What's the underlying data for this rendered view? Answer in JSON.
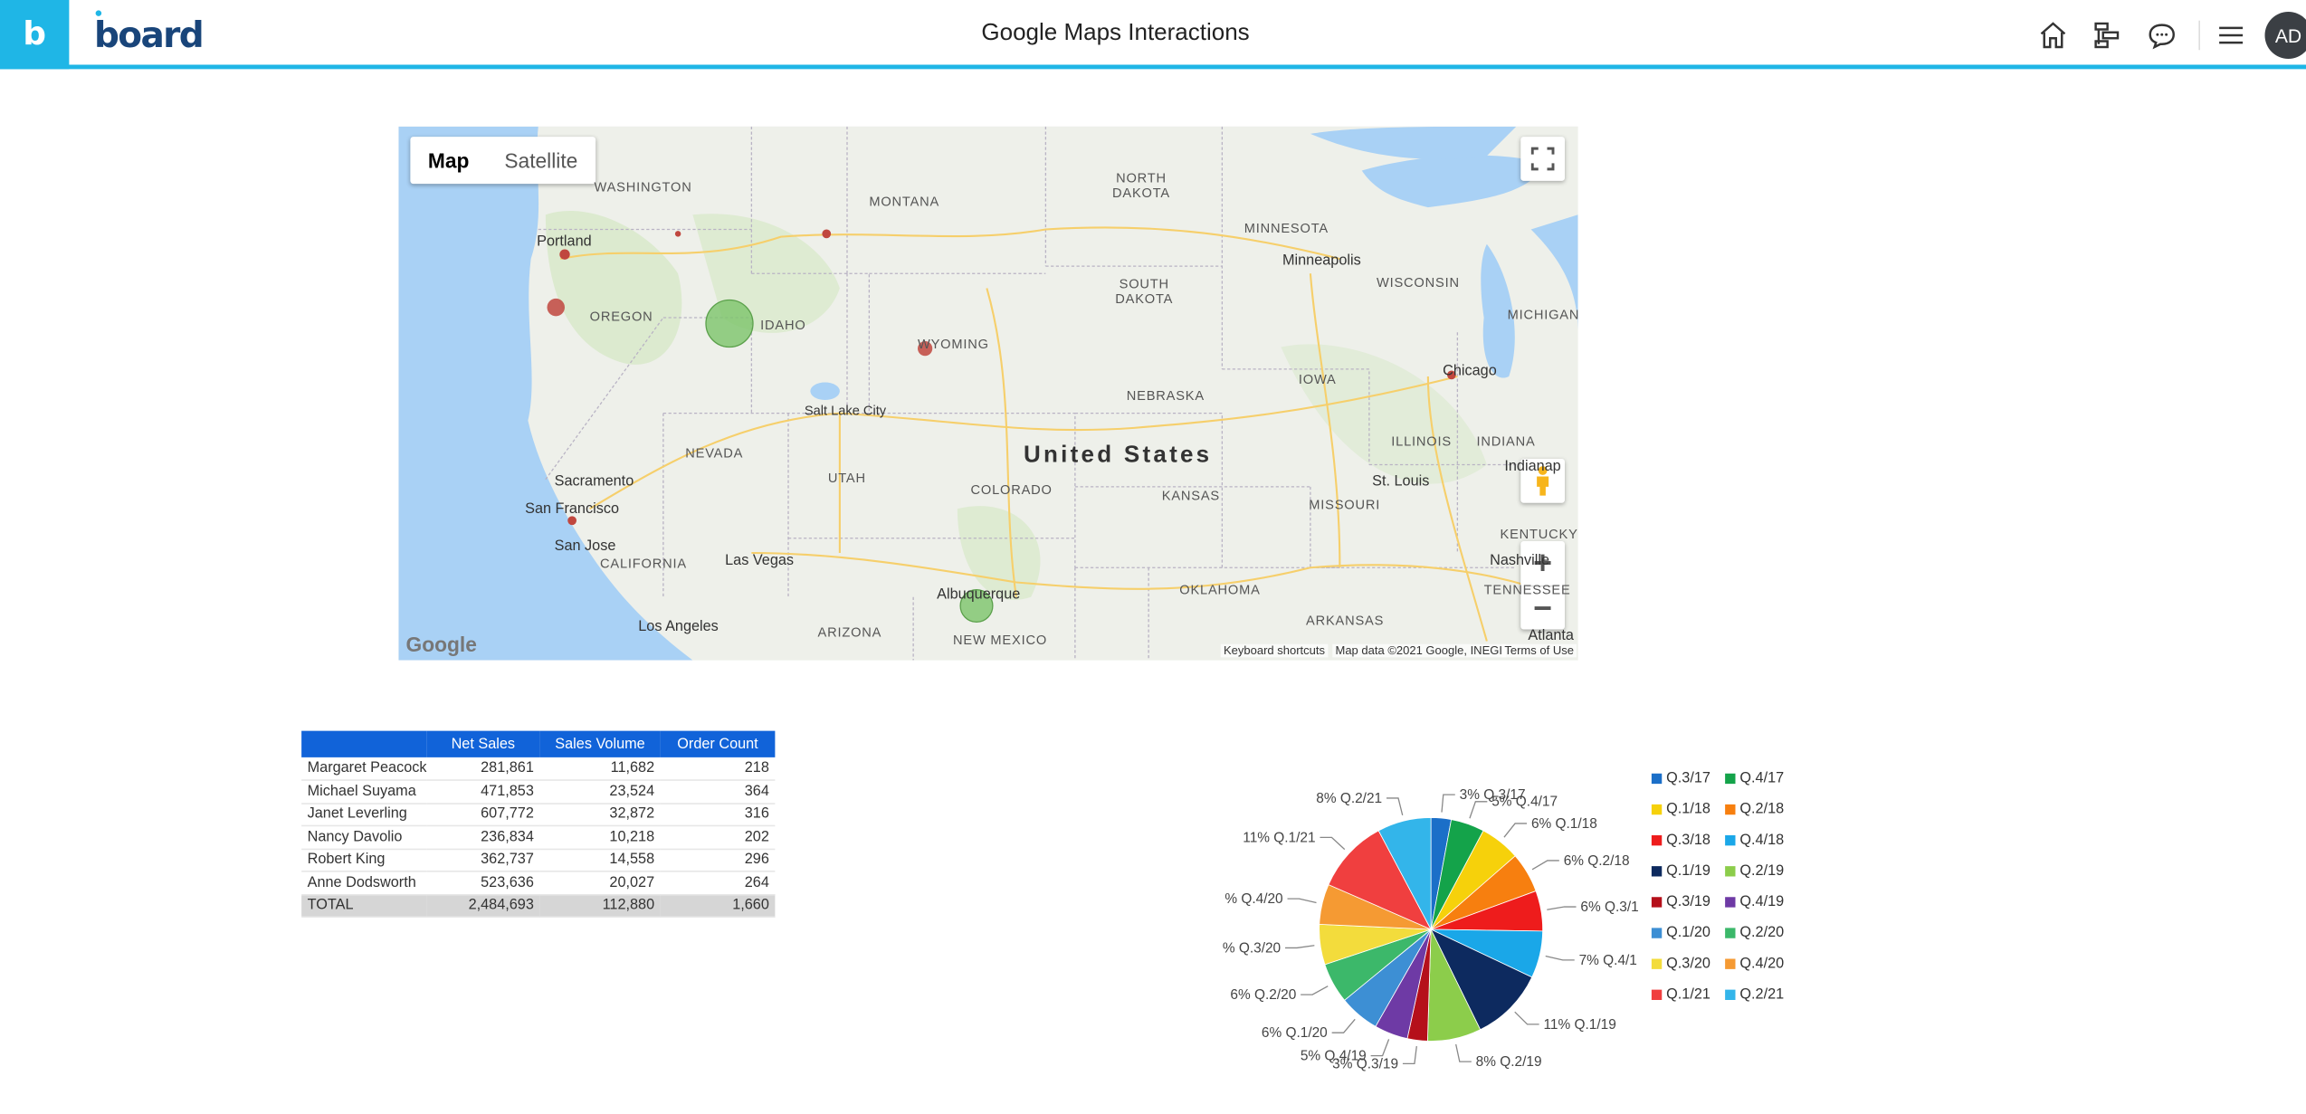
{
  "header": {
    "brand_letter": "b",
    "brand_name": "board",
    "title": "Google Maps Interactions",
    "avatar_initials": "AD",
    "icons": [
      "home-icon",
      "hierarchy-icon",
      "chat-icon",
      "menu-icon"
    ]
  },
  "map": {
    "type_map": "Map",
    "type_satellite": "Satellite",
    "country": "United States",
    "states": [
      "WASHINGTON",
      "MONTANA",
      "NORTH DAKOTA",
      "MINNESOTA",
      "OREGON",
      "IDAHO",
      "SOUTH DAKOTA",
      "WYOMING",
      "WISCONSIN",
      "MICHIGAN",
      "IOWA",
      "NEBRASKA",
      "NEVADA",
      "UTAH",
      "COLORADO",
      "KANSAS",
      "ILLINOIS",
      "INDIANA",
      "MISSOURI",
      "CALIFORNIA",
      "KENTUCKY",
      "ARIZONA",
      "NEW MEXICO",
      "OKLAHOMA",
      "ARKANSAS",
      "TENNESSEE"
    ],
    "cities": [
      "Portland",
      "Minneapolis",
      "Chicago",
      "Salt Lake City",
      "Sacramento",
      "San Francisco",
      "San Jose",
      "Las Vegas",
      "St. Louis",
      "Indianap",
      "Nashville",
      "Albuquerque",
      "Los Angeles",
      "Atlanta"
    ],
    "google": "Google",
    "footer_shortcuts": "Keyboard shortcuts",
    "footer_data": "Map data ©2021 Google, INEGI",
    "footer_terms": "Terms of Use",
    "colors": {
      "water": "#a9d1f5",
      "land": "#eef0ea",
      "green_marker": "#7cc46a",
      "red_marker": "#c0473e"
    }
  },
  "table": {
    "headers": [
      "",
      "Net Sales",
      "Sales Volume",
      "Order Count"
    ],
    "rows": [
      [
        "Margaret Peacock",
        "281,861",
        "11,682",
        "218"
      ],
      [
        "Michael Suyama",
        "471,853",
        "23,524",
        "364"
      ],
      [
        "Janet Leverling",
        "607,772",
        "32,872",
        "316"
      ],
      [
        "Nancy Davolio",
        "236,834",
        "10,218",
        "202"
      ],
      [
        "Robert King",
        "362,737",
        "14,558",
        "296"
      ],
      [
        "Anne Dodsworth",
        "523,636",
        "20,027",
        "264"
      ]
    ],
    "total": [
      "TOTAL",
      "2,484,693",
      "112,880",
      "1,660"
    ]
  },
  "chart_data": {
    "type": "pie",
    "categories": [
      "Q.3/17",
      "Q.4/17",
      "Q.1/18",
      "Q.2/18",
      "Q.3/18",
      "Q.4/18",
      "Q.1/19",
      "Q.2/19",
      "Q.3/19",
      "Q.4/19",
      "Q.1/20",
      "Q.2/20",
      "Q.3/20",
      "Q.4/20",
      "Q.1/21",
      "Q.2/21"
    ],
    "values": [
      3,
      5,
      6,
      6,
      6,
      7,
      11,
      8,
      3,
      5,
      6,
      6,
      6,
      6,
      11,
      8
    ],
    "labels": [
      "3% Q.3/17",
      "5% Q.4/17",
      "6% Q.1/18",
      "6% Q.2/18",
      "6% Q.3/1",
      "7% Q.4/1",
      "11% Q.1/19",
      "8% Q.2/19",
      "3% Q.3/19",
      "5% Q.4/19",
      "6% Q.1/20",
      "6% Q.2/20",
      "% Q.3/20",
      "% Q.4/20",
      "11% Q.1/21",
      "8% Q.2/21"
    ],
    "colors": [
      "#1b6fc8",
      "#14a34a",
      "#f6d10b",
      "#f77f0f",
      "#ee1c1c",
      "#1aa7e8",
      "#0d2a5f",
      "#8ccd4b",
      "#b5101a",
      "#6e3aa5",
      "#3d8fd4",
      "#3cb86a",
      "#f3dc3c",
      "#f59a33",
      "#f03f3f",
      "#33b5ea"
    ],
    "legend": "right"
  }
}
